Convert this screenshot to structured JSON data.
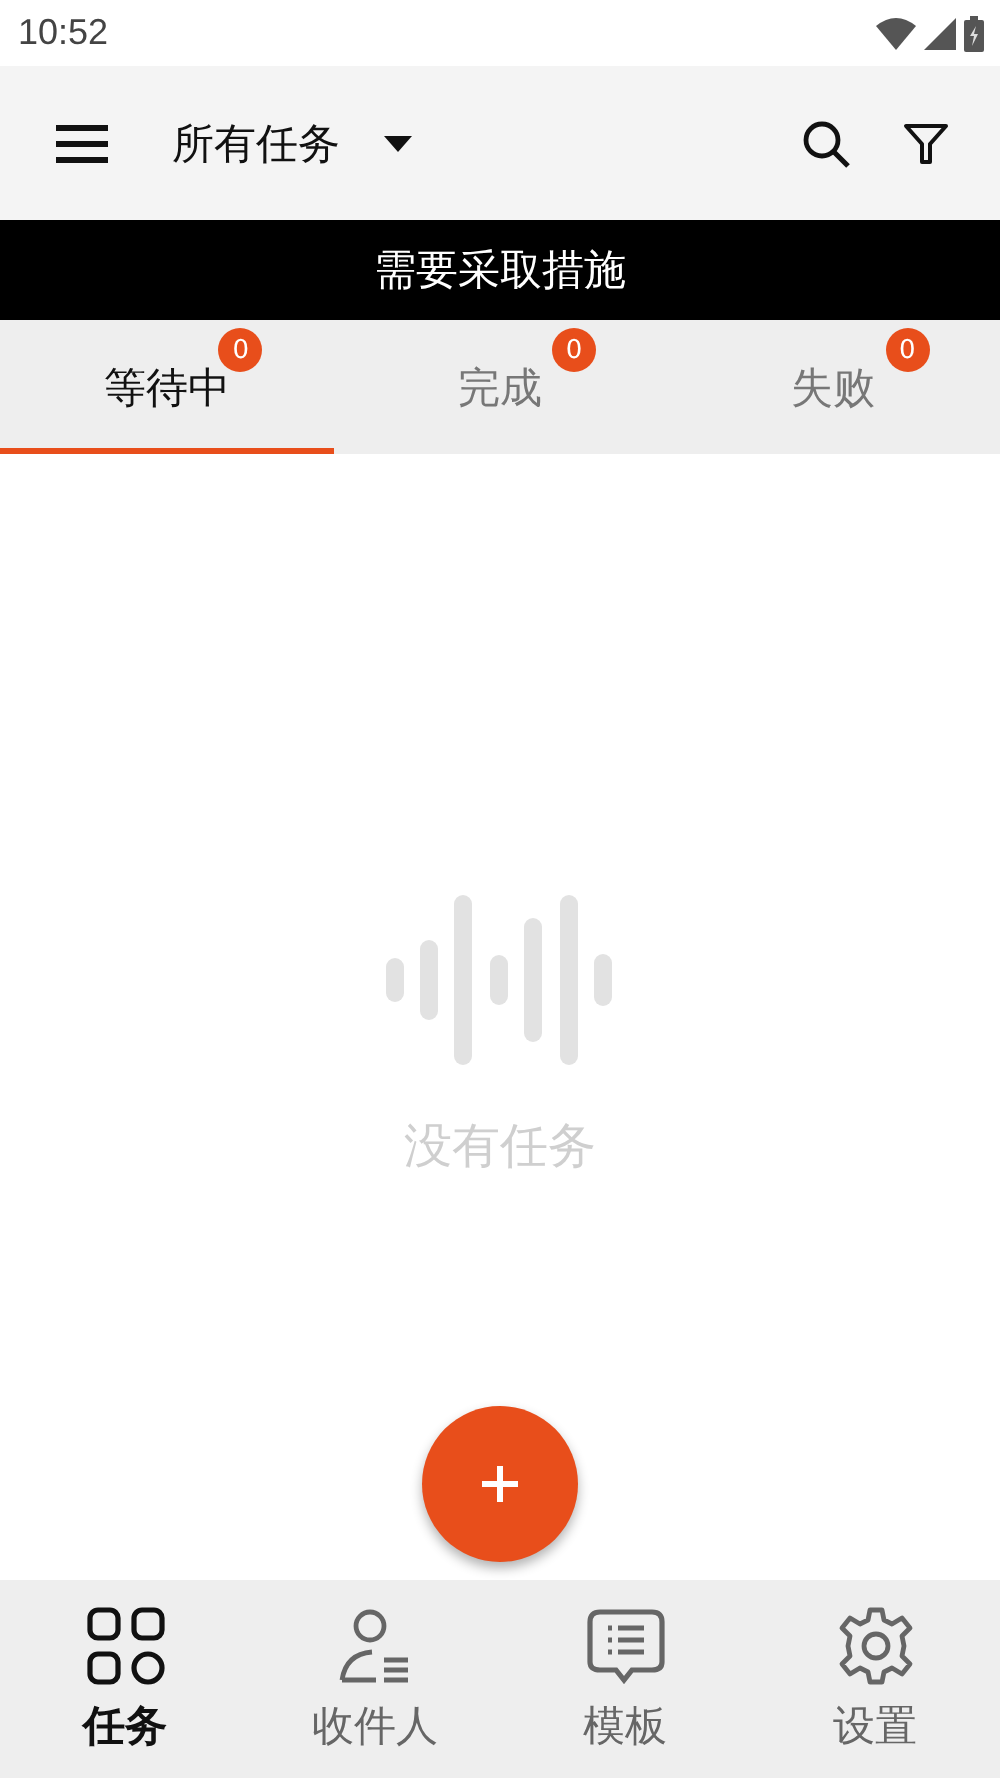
{
  "status_bar": {
    "time": "10:52"
  },
  "toolbar": {
    "title": "所有任务"
  },
  "banner": {
    "text": "需要采取措施"
  },
  "tabs": [
    {
      "label": "等待中",
      "count": "0",
      "selected": true
    },
    {
      "label": "完成",
      "count": "0",
      "selected": false
    },
    {
      "label": "失败",
      "count": "0",
      "selected": false
    }
  ],
  "empty_state": {
    "message": "没有任务"
  },
  "bottom_nav": [
    {
      "label": "任务",
      "selected": true
    },
    {
      "label": "收件人",
      "selected": false
    },
    {
      "label": "模板",
      "selected": false
    },
    {
      "label": "设置",
      "selected": false
    }
  ]
}
